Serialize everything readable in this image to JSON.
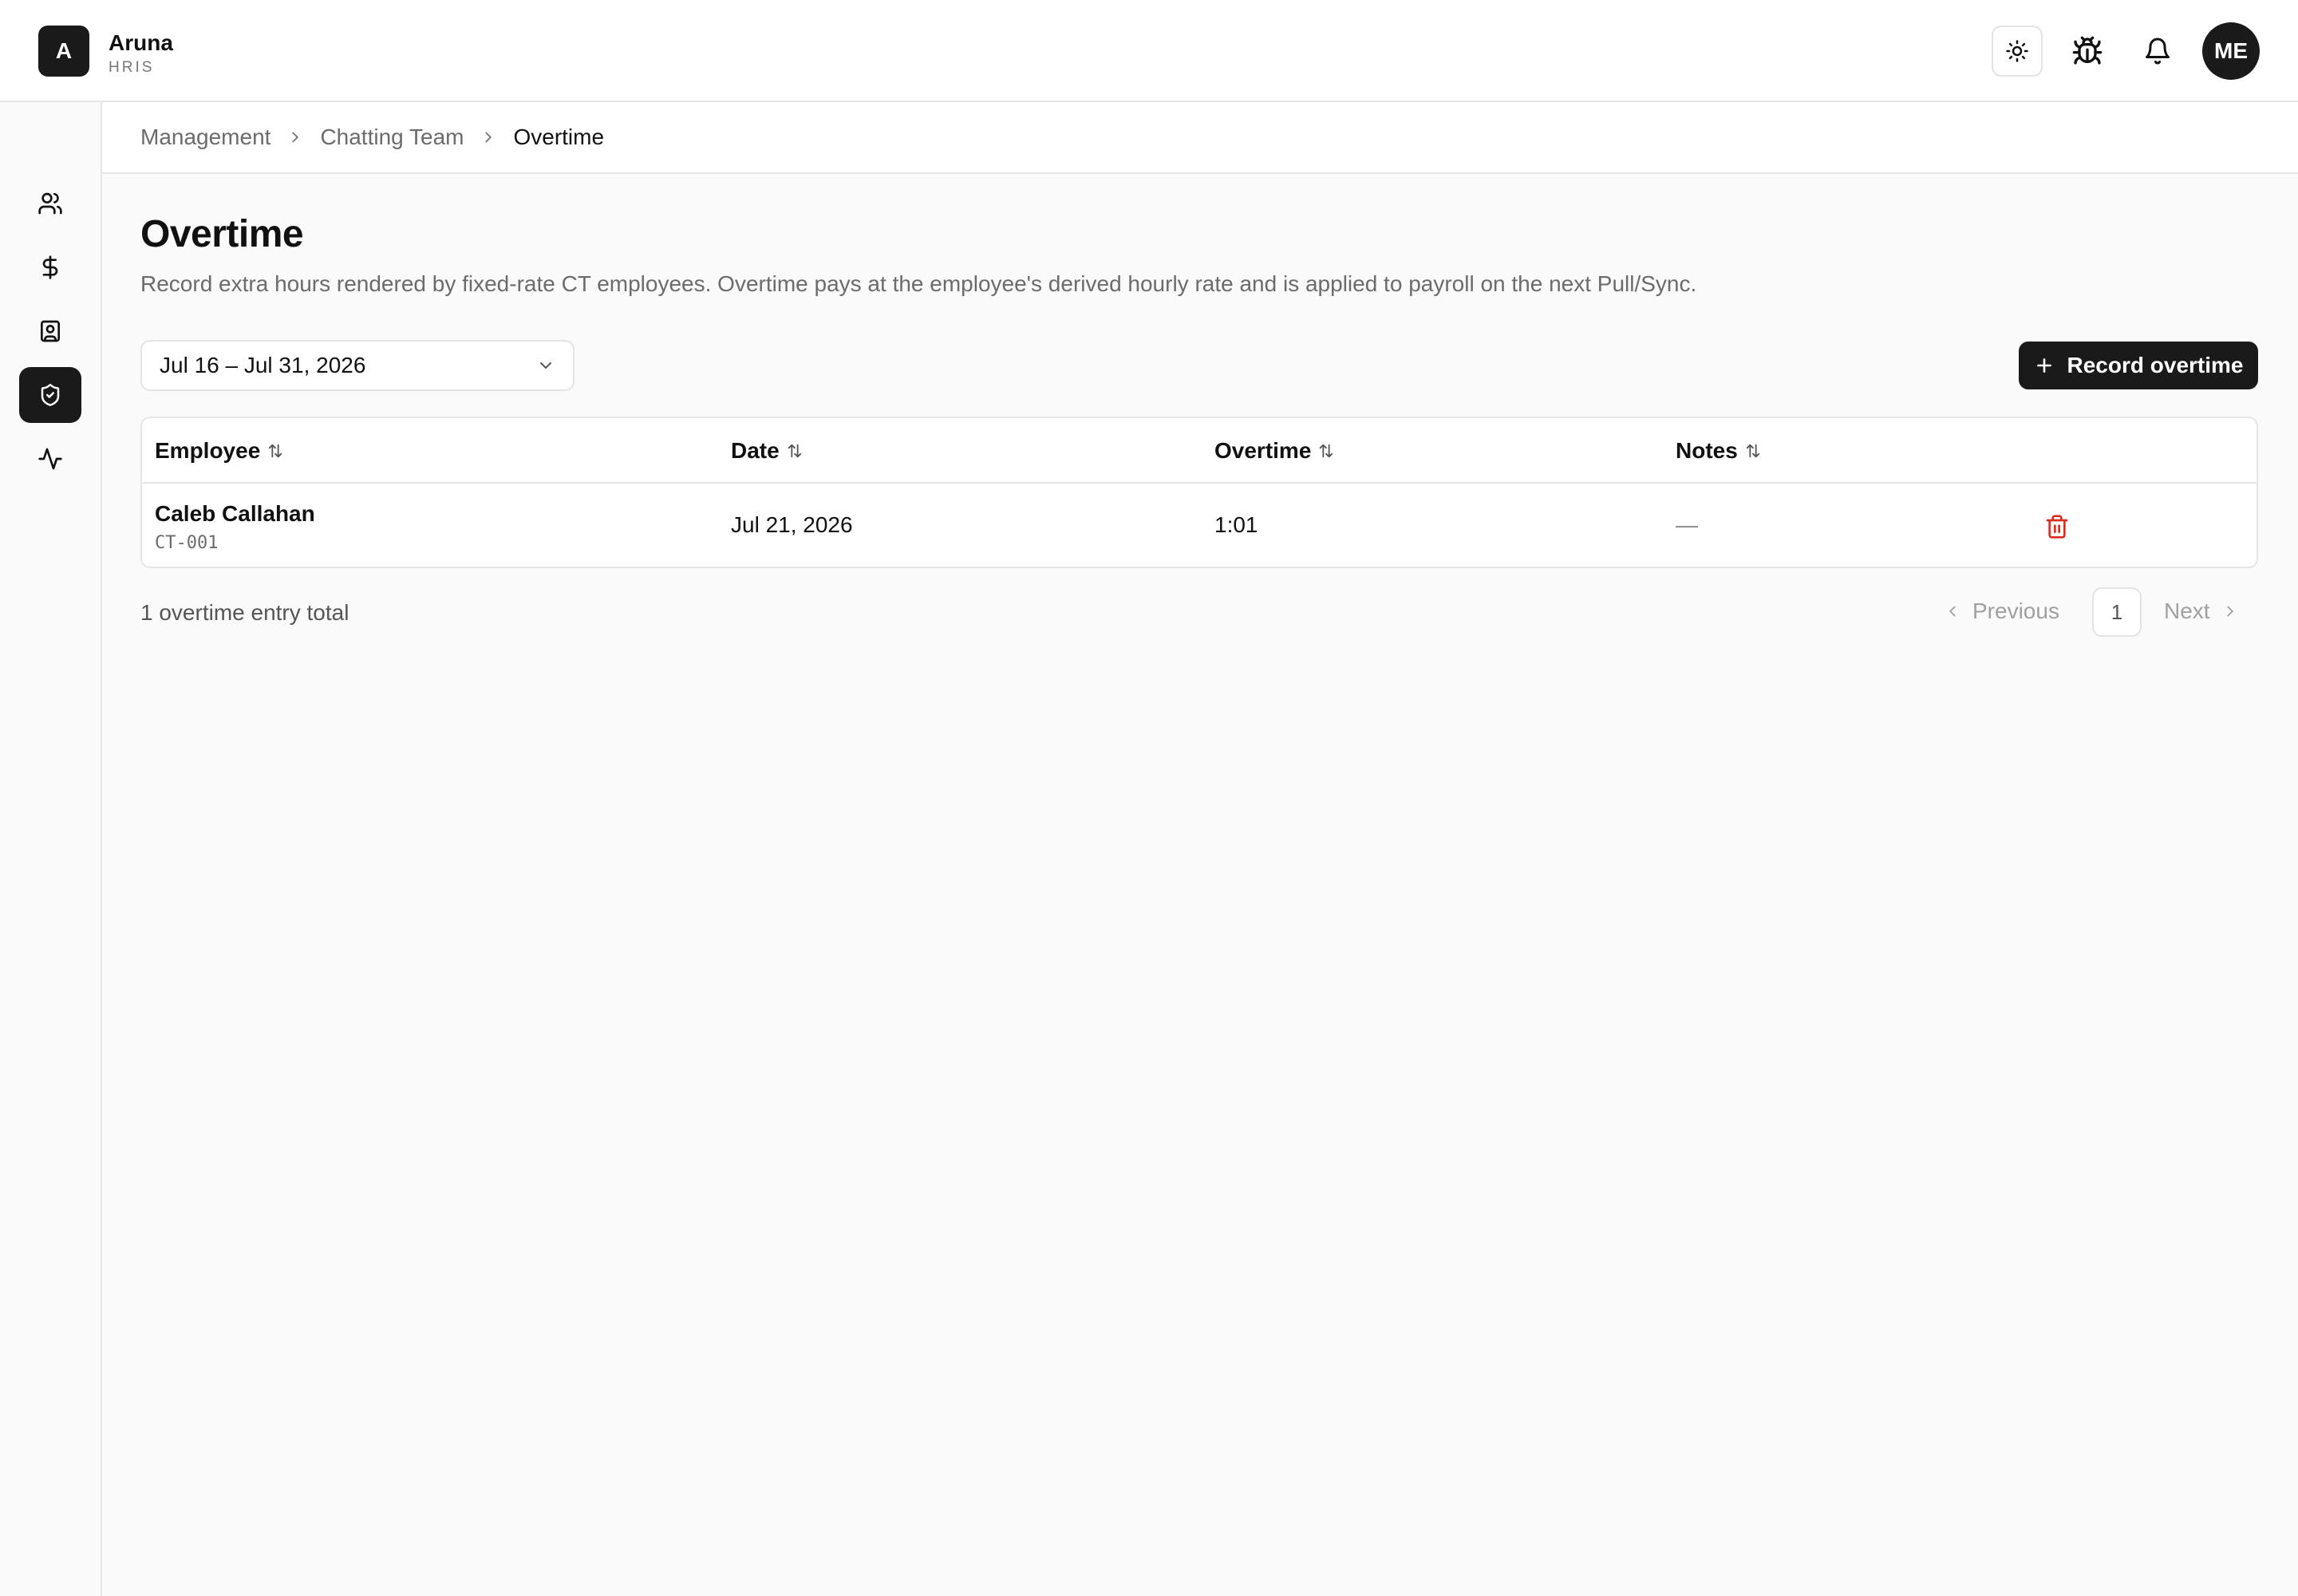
{
  "app": {
    "logo_letter": "A",
    "name": "Aruna",
    "subtitle": "HRIS",
    "avatar_initials": "ME"
  },
  "header_icons": [
    "sun-icon",
    "bug-icon",
    "bell-icon"
  ],
  "sidebar": {
    "items": [
      {
        "icon": "users-icon",
        "active": false
      },
      {
        "icon": "dollar-icon",
        "active": false
      },
      {
        "icon": "contact-card-icon",
        "active": false
      },
      {
        "icon": "shield-check-icon",
        "active": true
      },
      {
        "icon": "activity-icon",
        "active": false
      }
    ]
  },
  "breadcrumb": [
    "Management",
    "Chatting Team",
    "Overtime"
  ],
  "page": {
    "title": "Overtime",
    "description": "Record extra hours rendered by fixed-rate CT employees. Overtime pays at the employee's derived hourly rate and is applied to payroll on the next Pull/Sync."
  },
  "filter": {
    "period": "Jul 16 – Jul 31, 2026"
  },
  "actions": {
    "record_label": "Record overtime"
  },
  "table": {
    "columns": [
      "Employee",
      "Date",
      "Overtime",
      "Notes"
    ],
    "rows": [
      {
        "name": "Caleb Callahan",
        "id": "CT-001",
        "date": "Jul 21, 2026",
        "overtime": "1:01",
        "notes": "—"
      }
    ]
  },
  "footer": {
    "total_text": "1 overtime entry total",
    "prev_label": "Previous",
    "page": "1",
    "next_label": "Next"
  },
  "colors": {
    "accent": "#1a1a1a",
    "danger": "#d92d20",
    "muted": "#6b6b6b"
  }
}
